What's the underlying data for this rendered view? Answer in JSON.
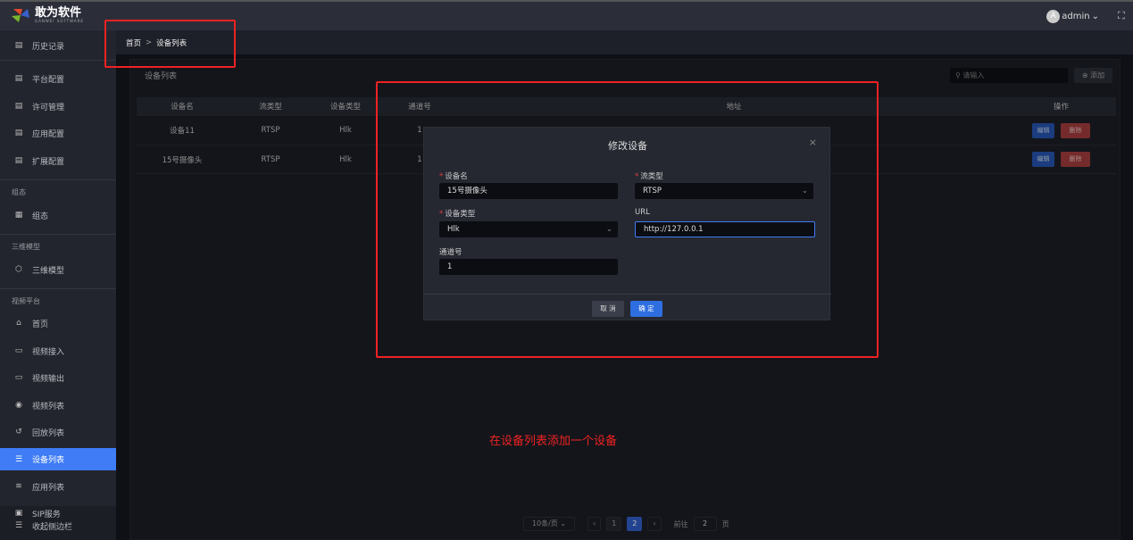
{
  "header": {
    "logo_title": "敢为软件",
    "logo_sub": "GANWEI SOFTWARE",
    "avatar_letter": "A",
    "user": "admin"
  },
  "sidebar": {
    "top_item": "历史记录",
    "config_items": [
      "平台配置",
      "许可管理",
      "应用配置",
      "扩展配置"
    ],
    "groups": [
      {
        "title": "组态",
        "items": [
          "组态"
        ]
      },
      {
        "title": "三维模型",
        "items": [
          "三维模型"
        ]
      },
      {
        "title": "视频平台",
        "items": [
          "首页",
          "视频接入",
          "视频输出",
          "视频列表",
          "回放列表",
          "设备列表",
          "应用列表",
          "SIP服务"
        ]
      }
    ],
    "collapse": "收起侧边栏"
  },
  "breadcrumb": {
    "home": "首页",
    "sep": ">",
    "current": "设备列表"
  },
  "card": {
    "title": "设备列表",
    "search_placeholder": "请输入",
    "add": "添加"
  },
  "table": {
    "headers": [
      "设备名",
      "流类型",
      "设备类型",
      "通道号",
      "地址",
      "操作"
    ],
    "rows": [
      {
        "name": "设备11",
        "stream": "RTSP",
        "type": "Hlk",
        "channel": "1"
      },
      {
        "name": "15号摄像头",
        "stream": "RTSP",
        "type": "Hlk",
        "channel": "1"
      }
    ],
    "edit": "编辑",
    "delete": "删除"
  },
  "modal": {
    "title": "修改设备",
    "close": "×",
    "fields": {
      "name_label": "设备名",
      "name_value": "15号摄像头",
      "stream_label": "流类型",
      "stream_value": "RTSP",
      "type_label": "设备类型",
      "type_value": "Hlk",
      "url_label": "URL",
      "url_value": "http://127.0.0.1",
      "channel_label": "通道号",
      "channel_value": "1"
    },
    "cancel": "取 消",
    "ok": "确 定"
  },
  "pagination": {
    "page_size": "10条/页",
    "pages": [
      "1",
      "2"
    ],
    "current": "2",
    "goto_label": "前往",
    "goto_value": "2",
    "goto_suffix": "页"
  },
  "annotation": "在设备列表添加一个设备"
}
